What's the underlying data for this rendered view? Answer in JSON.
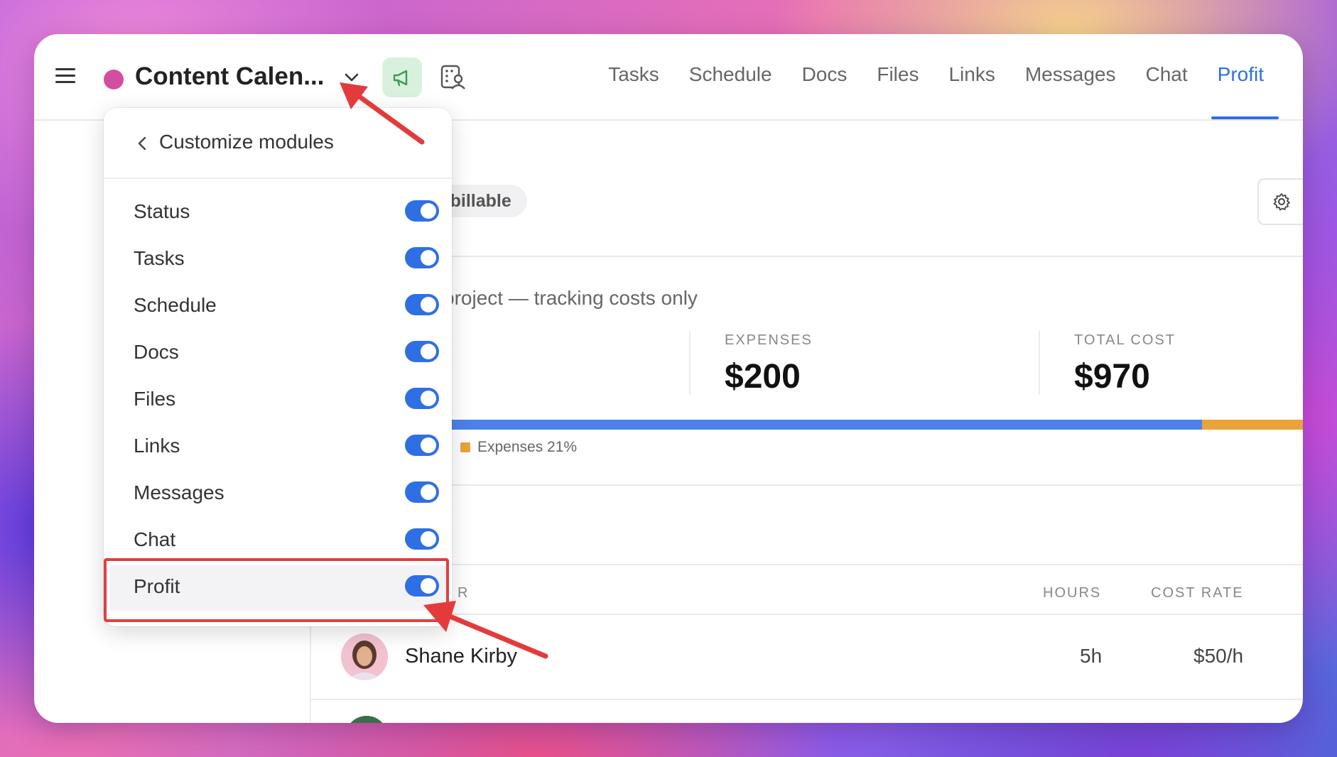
{
  "project": {
    "title": "Content Calen...",
    "dot_color": "#d44ea0"
  },
  "tabs": [
    {
      "label": "Tasks"
    },
    {
      "label": "Schedule"
    },
    {
      "label": "Docs"
    },
    {
      "label": "Files"
    },
    {
      "label": "Links"
    },
    {
      "label": "Messages"
    },
    {
      "label": "Chat"
    },
    {
      "label": "Profit",
      "active": true
    }
  ],
  "accent_color": "#2f6fe4",
  "profit": {
    "chip": "n-billable",
    "subtitle": "project — tracking costs only",
    "stats": [
      {
        "label": "EXPENSES",
        "value": "$200"
      },
      {
        "label": "TOTAL COST",
        "value": "$970"
      }
    ],
    "cost_split": {
      "expenses_fraction": 0.21
    },
    "legend": {
      "expenses": "Expenses 21%"
    },
    "table": {
      "headers": {
        "member_partial": "R",
        "hours": "HOURS",
        "cost_rate": "COST RATE"
      },
      "rows": [
        {
          "name": "Shane Kirby",
          "hours": "5h",
          "rate": "$50/h"
        }
      ]
    }
  },
  "dropdown": {
    "title": "Customize modules",
    "items": [
      {
        "label": "Status",
        "on": true
      },
      {
        "label": "Tasks",
        "on": true
      },
      {
        "label": "Schedule",
        "on": true
      },
      {
        "label": "Docs",
        "on": true
      },
      {
        "label": "Files",
        "on": true
      },
      {
        "label": "Links",
        "on": true
      },
      {
        "label": "Messages",
        "on": true
      },
      {
        "label": "Chat",
        "on": true
      },
      {
        "label": "Profit",
        "on": true
      }
    ]
  }
}
